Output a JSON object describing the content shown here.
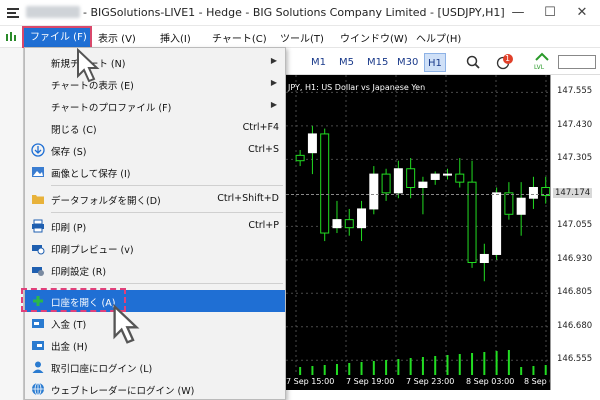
{
  "window": {
    "title": "- BIGSolutions-LIVE1 - Hedge - BIG Solutions Company Limited - [USDJPY,H1]",
    "minimize_icon": "minimize-icon",
    "maximize_icon": "maximize-icon",
    "close_icon": "close-icon"
  },
  "menubar": {
    "file": "ファイル (F)",
    "view": "表示 (V)",
    "insert": "挿入(I)",
    "chart": "チャート(C)",
    "tools": "ツール(T)",
    "window": "ウインドウ(W)",
    "help": "ヘルプ(H)"
  },
  "toolbar": {
    "timeframes": [
      "M1",
      "M5",
      "M15",
      "M30",
      "H1"
    ],
    "active_timeframe": "H1",
    "notification_count": "1",
    "lvl_label": "LVL"
  },
  "file_menu": {
    "items": [
      {
        "label": "新規チャート (N)",
        "shortcut": "",
        "submenu": true,
        "icon": "none"
      },
      {
        "label": "チャートの表示 (E)",
        "shortcut": "",
        "submenu": true,
        "icon": "none"
      },
      {
        "label": "チャートのプロファイル (F)",
        "shortcut": "",
        "submenu": true,
        "icon": "none"
      },
      {
        "label": "閉じる (C)",
        "shortcut": "Ctrl+F4",
        "submenu": false,
        "icon": "none"
      },
      {
        "label": "保存 (S)",
        "shortcut": "Ctrl+S",
        "submenu": false,
        "icon": "save-icon"
      },
      {
        "label": "画像として保存 (I)",
        "shortcut": "",
        "submenu": false,
        "icon": "image-icon"
      },
      {
        "label": "データフォルダを開く(D)",
        "shortcut": "Ctrl+Shift+D",
        "submenu": false,
        "icon": "folder-icon"
      },
      {
        "label": "印刷 (P)",
        "shortcut": "Ctrl+P",
        "submenu": false,
        "icon": "print-icon"
      },
      {
        "label": "印刷プレビュー (v)",
        "shortcut": "",
        "submenu": false,
        "icon": "print-preview-icon"
      },
      {
        "label": "印刷設定 (R)",
        "shortcut": "",
        "submenu": false,
        "icon": "print-settings-icon"
      },
      {
        "label": "口座を開く (A)",
        "shortcut": "",
        "submenu": false,
        "icon": "add-icon",
        "highlighted": true
      },
      {
        "label": "入金 (T)",
        "shortcut": "",
        "submenu": false,
        "icon": "deposit-icon"
      },
      {
        "label": "出金 (H)",
        "shortcut": "",
        "submenu": false,
        "icon": "withdraw-icon"
      },
      {
        "label": "取引口座にログイン (L)",
        "shortcut": "",
        "submenu": false,
        "icon": "user-icon"
      },
      {
        "label": "ウェブトレーダーにログイン (W)",
        "shortcut": "",
        "submenu": false,
        "icon": "globe-icon"
      }
    ]
  },
  "chart": {
    "title": "JPY, H1:  US Dollar vs Japanese Yen",
    "price_labels": [
      "147.555",
      "147.430",
      "147.305",
      "147.174",
      "147.055",
      "146.930",
      "146.805",
      "146.680",
      "146.555"
    ],
    "current_price": "147.174",
    "time_labels": [
      "7 Sep 15:00",
      "7 Sep 19:00",
      "7 Sep 23:00",
      "8 Sep 03:00",
      "8 Sep 07:00"
    ],
    "bull_color": "#ffffff",
    "bear_color": "#000000",
    "wick_color": "#22dd22",
    "volume_color": "#22dd22",
    "grid_color": "#4a4a4a"
  },
  "chart_data": {
    "type": "candlestick",
    "ylim": [
      146.5,
      147.62
    ],
    "candles": [
      {
        "o": 147.32,
        "h": 147.34,
        "l": 147.28,
        "c": 147.3
      },
      {
        "o": 147.33,
        "h": 147.43,
        "l": 147.25,
        "c": 147.4
      },
      {
        "o": 147.4,
        "h": 147.42,
        "l": 147.0,
        "c": 147.03
      },
      {
        "o": 147.05,
        "h": 147.15,
        "l": 147.03,
        "c": 147.08
      },
      {
        "o": 147.08,
        "h": 147.12,
        "l": 147.02,
        "c": 147.05
      },
      {
        "o": 147.05,
        "h": 147.15,
        "l": 147.0,
        "c": 147.12
      },
      {
        "o": 147.12,
        "h": 147.28,
        "l": 147.1,
        "c": 147.25
      },
      {
        "o": 147.25,
        "h": 147.27,
        "l": 147.15,
        "c": 147.18
      },
      {
        "o": 147.18,
        "h": 147.3,
        "l": 147.16,
        "c": 147.27
      },
      {
        "o": 147.27,
        "h": 147.31,
        "l": 147.16,
        "c": 147.2
      },
      {
        "o": 147.2,
        "h": 147.24,
        "l": 147.1,
        "c": 147.22
      },
      {
        "o": 147.23,
        "h": 147.26,
        "l": 147.21,
        "c": 147.25
      },
      {
        "o": 147.25,
        "h": 147.27,
        "l": 147.23,
        "c": 147.25
      },
      {
        "o": 147.25,
        "h": 147.31,
        "l": 147.2,
        "c": 147.22
      },
      {
        "o": 147.22,
        "h": 147.3,
        "l": 146.9,
        "c": 146.92
      },
      {
        "o": 146.92,
        "h": 146.99,
        "l": 146.85,
        "c": 146.95
      },
      {
        "o": 146.95,
        "h": 147.2,
        "l": 146.93,
        "c": 147.18
      },
      {
        "o": 147.18,
        "h": 147.22,
        "l": 147.08,
        "c": 147.1
      },
      {
        "o": 147.1,
        "h": 147.22,
        "l": 147.02,
        "c": 147.16
      },
      {
        "o": 147.16,
        "h": 147.24,
        "l": 147.12,
        "c": 147.2
      },
      {
        "o": 147.2,
        "h": 147.24,
        "l": 147.14,
        "c": 147.17
      }
    ]
  }
}
